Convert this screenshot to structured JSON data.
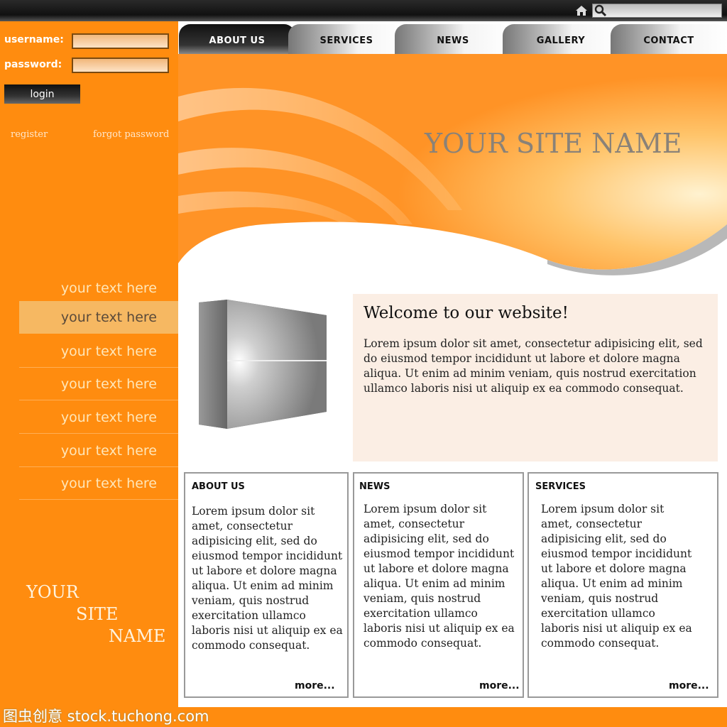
{
  "login": {
    "username_label": "username:",
    "password_label": "password:",
    "username_value": "",
    "password_value": "",
    "login_label": "login",
    "register_label": "register",
    "forgot_label": "forgot password"
  },
  "tabs": [
    {
      "label": "ABOUT US",
      "active": true
    },
    {
      "label": "SERVICES",
      "active": false
    },
    {
      "label": "NEWS",
      "active": false
    },
    {
      "label": "GALLERY",
      "active": false
    },
    {
      "label": "CONTACT",
      "active": false
    }
  ],
  "header": {
    "site_name": "YOUR SITE NAME"
  },
  "sidebar": {
    "nav_items": [
      "your text here",
      "your text here",
      "your text here",
      "your text here",
      "your text here",
      "your text here",
      "your text here"
    ],
    "site_name_lines": [
      "YOUR",
      "SITE",
      "NAME"
    ]
  },
  "welcome": {
    "title": "Welcome to our website!",
    "text": "Lorem ipsum dolor sit amet, consectetur adipisicing elit, sed do eiusmod tempor incididunt ut labore et dolore magna aliqua. Ut enim ad minim veniam, quis nostrud exercitation ullamco laboris nisi ut aliquip ex ea commodo consequat."
  },
  "boxes": [
    {
      "title": "ABOUT US",
      "text": "Lorem ipsum dolor sit amet, consectetur adipisicing elit, sed do eiusmod tempor incididunt ut labore et dolore magna aliqua. Ut enim ad minim veniam, quis nostrud exercitation ullamco laboris nisi ut aliquip ex ea commodo consequat.",
      "more": "more..."
    },
    {
      "title": "NEWS",
      "text": "Lorem ipsum dolor sit amet, consectetur adipisicing elit, sed do eiusmod tempor incididunt ut labore et dolore magna aliqua. Ut enim ad minim veniam, quis nostrud exercitation ullamco laboris nisi ut aliquip ex ea commodo consequat.",
      "more": "more..."
    },
    {
      "title": "SERVICES",
      "text": "Lorem ipsum dolor sit amet, consectetur adipisicing elit, sed do eiusmod tempor incididunt ut labore et dolore magna aliqua. Ut enim ad minim veniam, quis nostrud exercitation ullamco laboris nisi ut aliquip ex ea commodo consequat.",
      "more": "more..."
    }
  ],
  "watermark": "图虫创意 stock.tuchong.com",
  "icons": {
    "home": "home-icon",
    "search": "search-icon"
  },
  "colors": {
    "accent": "#ff8c0f",
    "welcome_bg": "#fbeee4",
    "dark_bar": "#1a1a1a"
  }
}
